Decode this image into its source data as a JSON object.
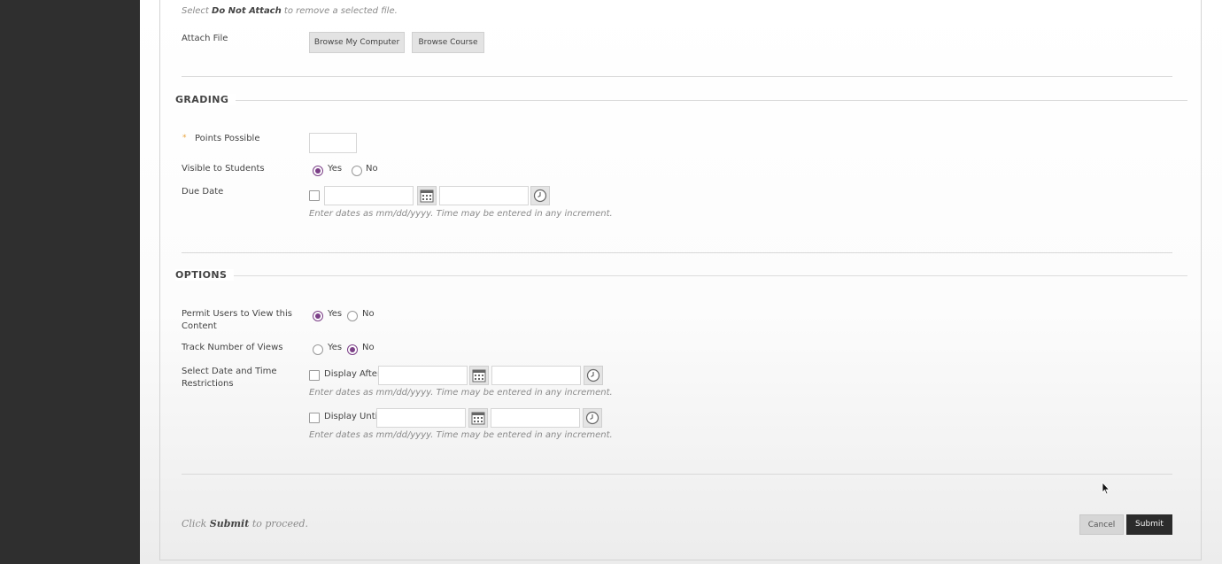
{
  "attach": {
    "hint_prefix": "Select ",
    "hint_bold": "Do Not Attach",
    "hint_suffix": " to remove a selected file.",
    "label": "Attach File",
    "browse_computer": "Browse My Computer",
    "browse_course": "Browse Course"
  },
  "grading": {
    "title": "GRADING",
    "required_marker": "*",
    "points_label": "Points Possible",
    "points_value": "",
    "visible_label": "Visible to Students",
    "visible_yes": "Yes",
    "visible_no": "No",
    "visible_selected": "Yes",
    "due_label": "Due Date",
    "due_hint": "Enter dates as mm/dd/yyyy. Time may be entered in any increment."
  },
  "options": {
    "title": "OPTIONS",
    "permit_label_line1": "Permit Users to View this",
    "permit_label_line2": "Content",
    "permit_yes": "Yes",
    "permit_no": "No",
    "permit_selected": "Yes",
    "track_label": "Track Number of Views",
    "track_yes": "Yes",
    "track_no": "No",
    "track_selected": "No",
    "restrict_label_line1": "Select Date and Time",
    "restrict_label_line2": "Restrictions",
    "display_after": "Display After",
    "display_until": "Display Until",
    "date_hint": "Enter dates as mm/dd/yyyy. Time may be entered in any increment."
  },
  "footer": {
    "hint_prefix": "Click ",
    "hint_bold": "Submit",
    "hint_suffix": " to proceed.",
    "cancel": "Cancel",
    "submit": "Submit"
  },
  "icons": {
    "calendar": "calendar-icon",
    "clock": "clock-icon",
    "cursor": "mouse-cursor-icon"
  },
  "colors": {
    "radio_accent": "#7b3f87",
    "required": "#e8a23a",
    "submit_bg": "#2b2b2b"
  }
}
